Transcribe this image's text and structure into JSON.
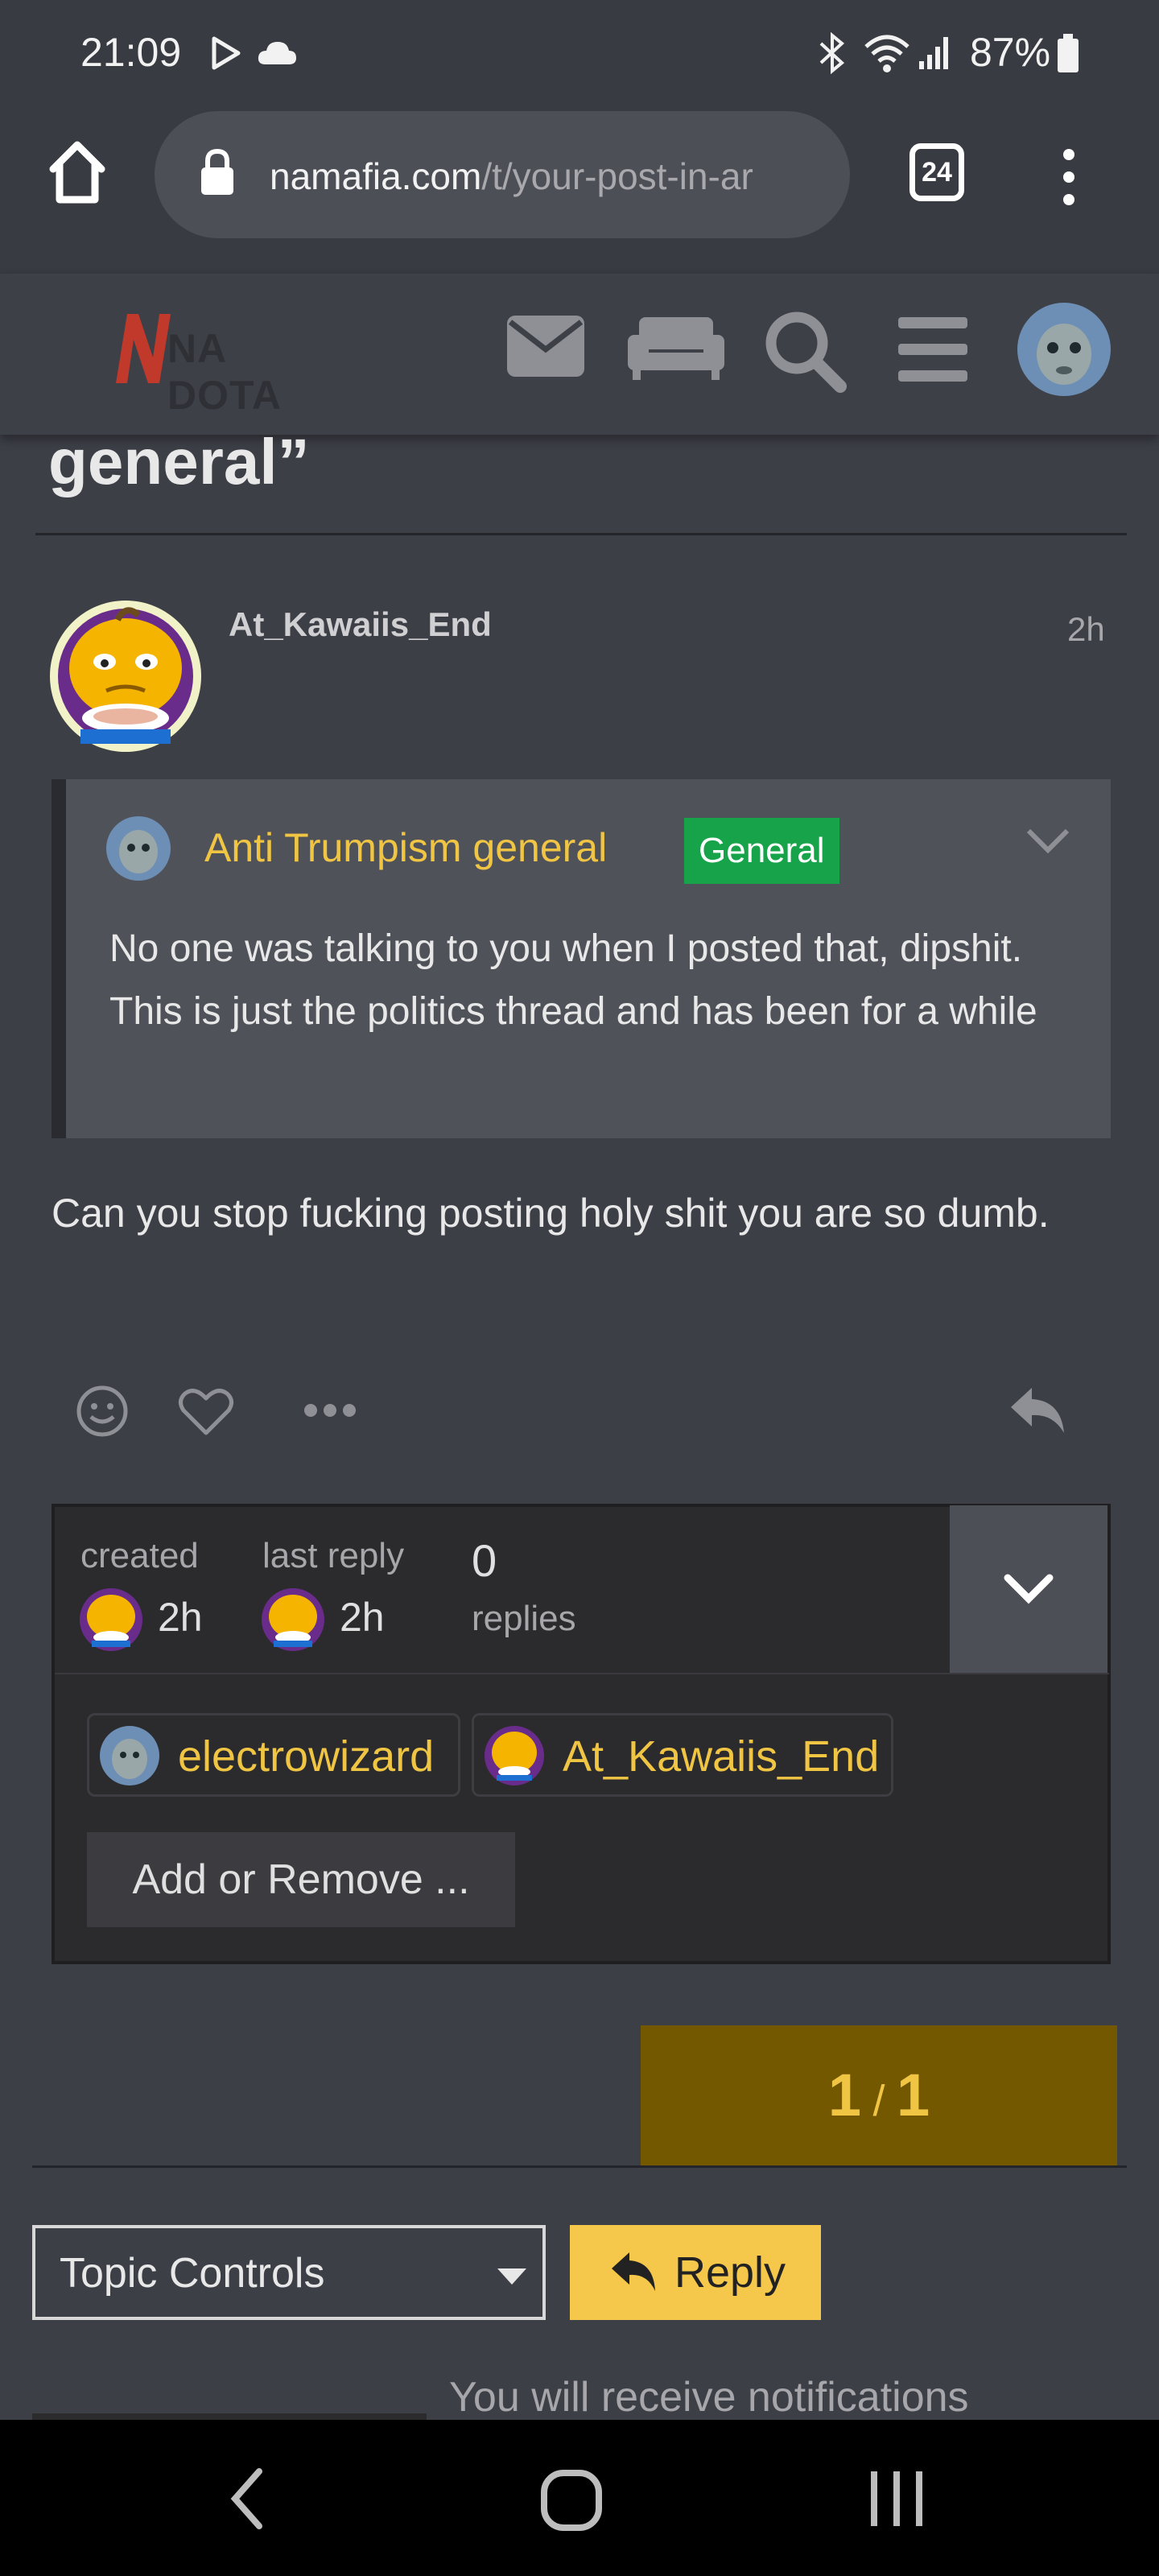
{
  "status_bar": {
    "time": "21:09",
    "battery": "87%",
    "icons": [
      "play-icon",
      "cloud-icon",
      "bluetooth-icon",
      "wifi-icon",
      "signal-icon",
      "battery-icon"
    ]
  },
  "browser": {
    "url_domain": "namafia.com",
    "url_path": "/t/your-post-in-ar",
    "tab_count": "24"
  },
  "site_header": {
    "logo_text": "NA DOTA",
    "icons": [
      "mail-icon",
      "couch-icon",
      "search-icon",
      "hamburger-icon",
      "avatar"
    ]
  },
  "topic": {
    "title_tail": "general”"
  },
  "post": {
    "author": "At_Kawaiis_End",
    "age": "2h",
    "quote": {
      "title": "Anti Trumpism general",
      "category": "General",
      "text": "No one was talking to you when I posted that, dipshit. This is just the politics thread and has been for a while"
    },
    "body": "Can you stop fucking posting holy shit you are so dumb."
  },
  "topic_map": {
    "created_label": "created",
    "created_value": "2h",
    "last_reply_label": "last reply",
    "last_reply_value": "2h",
    "replies_count": "0",
    "replies_label": "replies",
    "participants": [
      "electrowizard",
      "At_Kawaiis_End"
    ],
    "add_remove_label": "Add or Remove ..."
  },
  "progress": {
    "current": "1",
    "separator": "/",
    "total": "1"
  },
  "footer": {
    "topic_controls_label": "Topic Controls",
    "reply_label": "Reply",
    "notification_text": "You will receive notifications"
  },
  "colors": {
    "accent": "#f0c544",
    "category_badge": "#16a34a",
    "reply_button": "#f5c84b",
    "progress_bg": "#735800"
  }
}
